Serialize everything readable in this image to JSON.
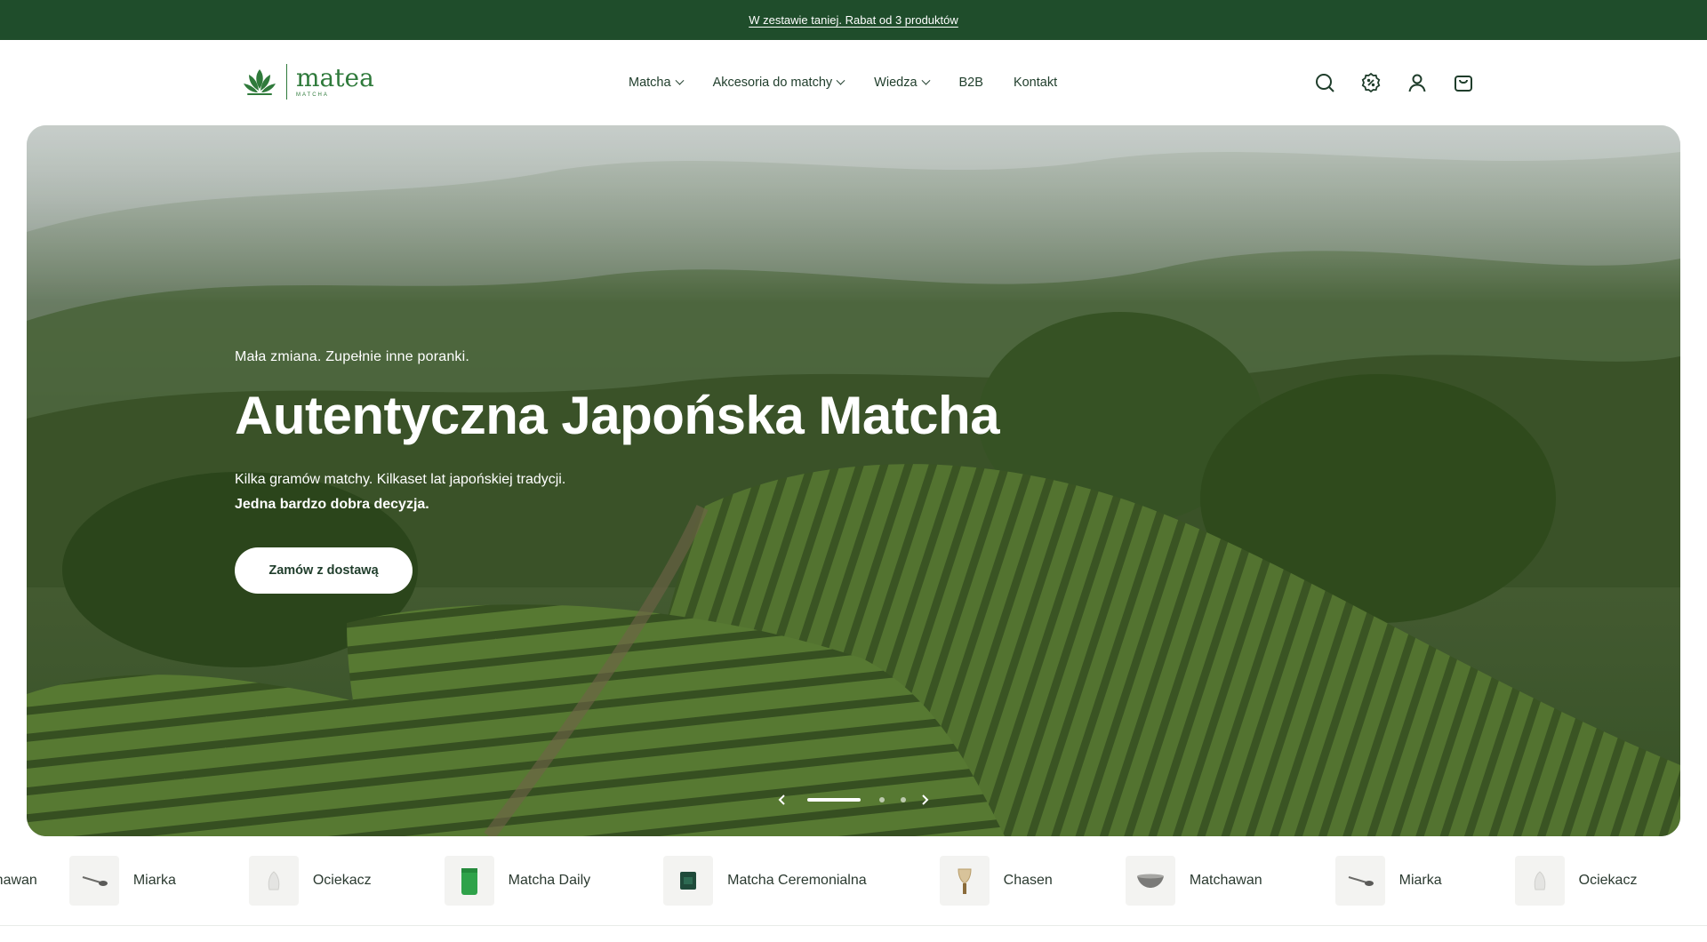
{
  "announcement": {
    "text": "W zestawie taniej. Rabat od 3 produktów"
  },
  "logo": {
    "name": "matea",
    "subtitle": "MATCHA"
  },
  "nav": {
    "items": [
      {
        "label": "Matcha",
        "dropdown": true
      },
      {
        "label": "Akcesoria do matchy",
        "dropdown": true
      },
      {
        "label": "Wiedza",
        "dropdown": true
      },
      {
        "label": "B2B",
        "dropdown": false
      },
      {
        "label": "Kontakt",
        "dropdown": false
      }
    ]
  },
  "header_icons": [
    "search-icon",
    "discount-badge-icon",
    "account-icon",
    "cart-icon"
  ],
  "hero": {
    "eyebrow": "Mała zmiana. Zupełnie inne poranki.",
    "title": "Autentyczna Japońska Matcha",
    "text_line1": "Kilka gramów matchy. Kilkaset lat japońskiej tradycji.",
    "text_line2": "Jedna bardzo dobra decyzja.",
    "button": "Zamów z dostawą",
    "slides_count": 3,
    "active_slide": 1
  },
  "products": [
    {
      "label": "Matchawan",
      "icon": "bowl-icon"
    },
    {
      "label": "Miarka",
      "icon": "scoop-icon"
    },
    {
      "label": "Ociekacz",
      "icon": "whisk-holder-icon"
    },
    {
      "label": "Matcha Daily",
      "icon": "green-pouch-icon"
    },
    {
      "label": "Matcha Ceremonialna",
      "icon": "dark-tin-icon"
    },
    {
      "label": "Chasen",
      "icon": "whisk-icon"
    },
    {
      "label": "Matchawan",
      "icon": "bowl-icon"
    },
    {
      "label": "Miarka",
      "icon": "scoop-icon"
    },
    {
      "label": "Ociekacz",
      "icon": "whisk-holder-icon"
    }
  ],
  "colors": {
    "brand_green": "#1f4d2b",
    "logo_green": "#2f7a3b",
    "text_dark": "#1f3d2b"
  }
}
